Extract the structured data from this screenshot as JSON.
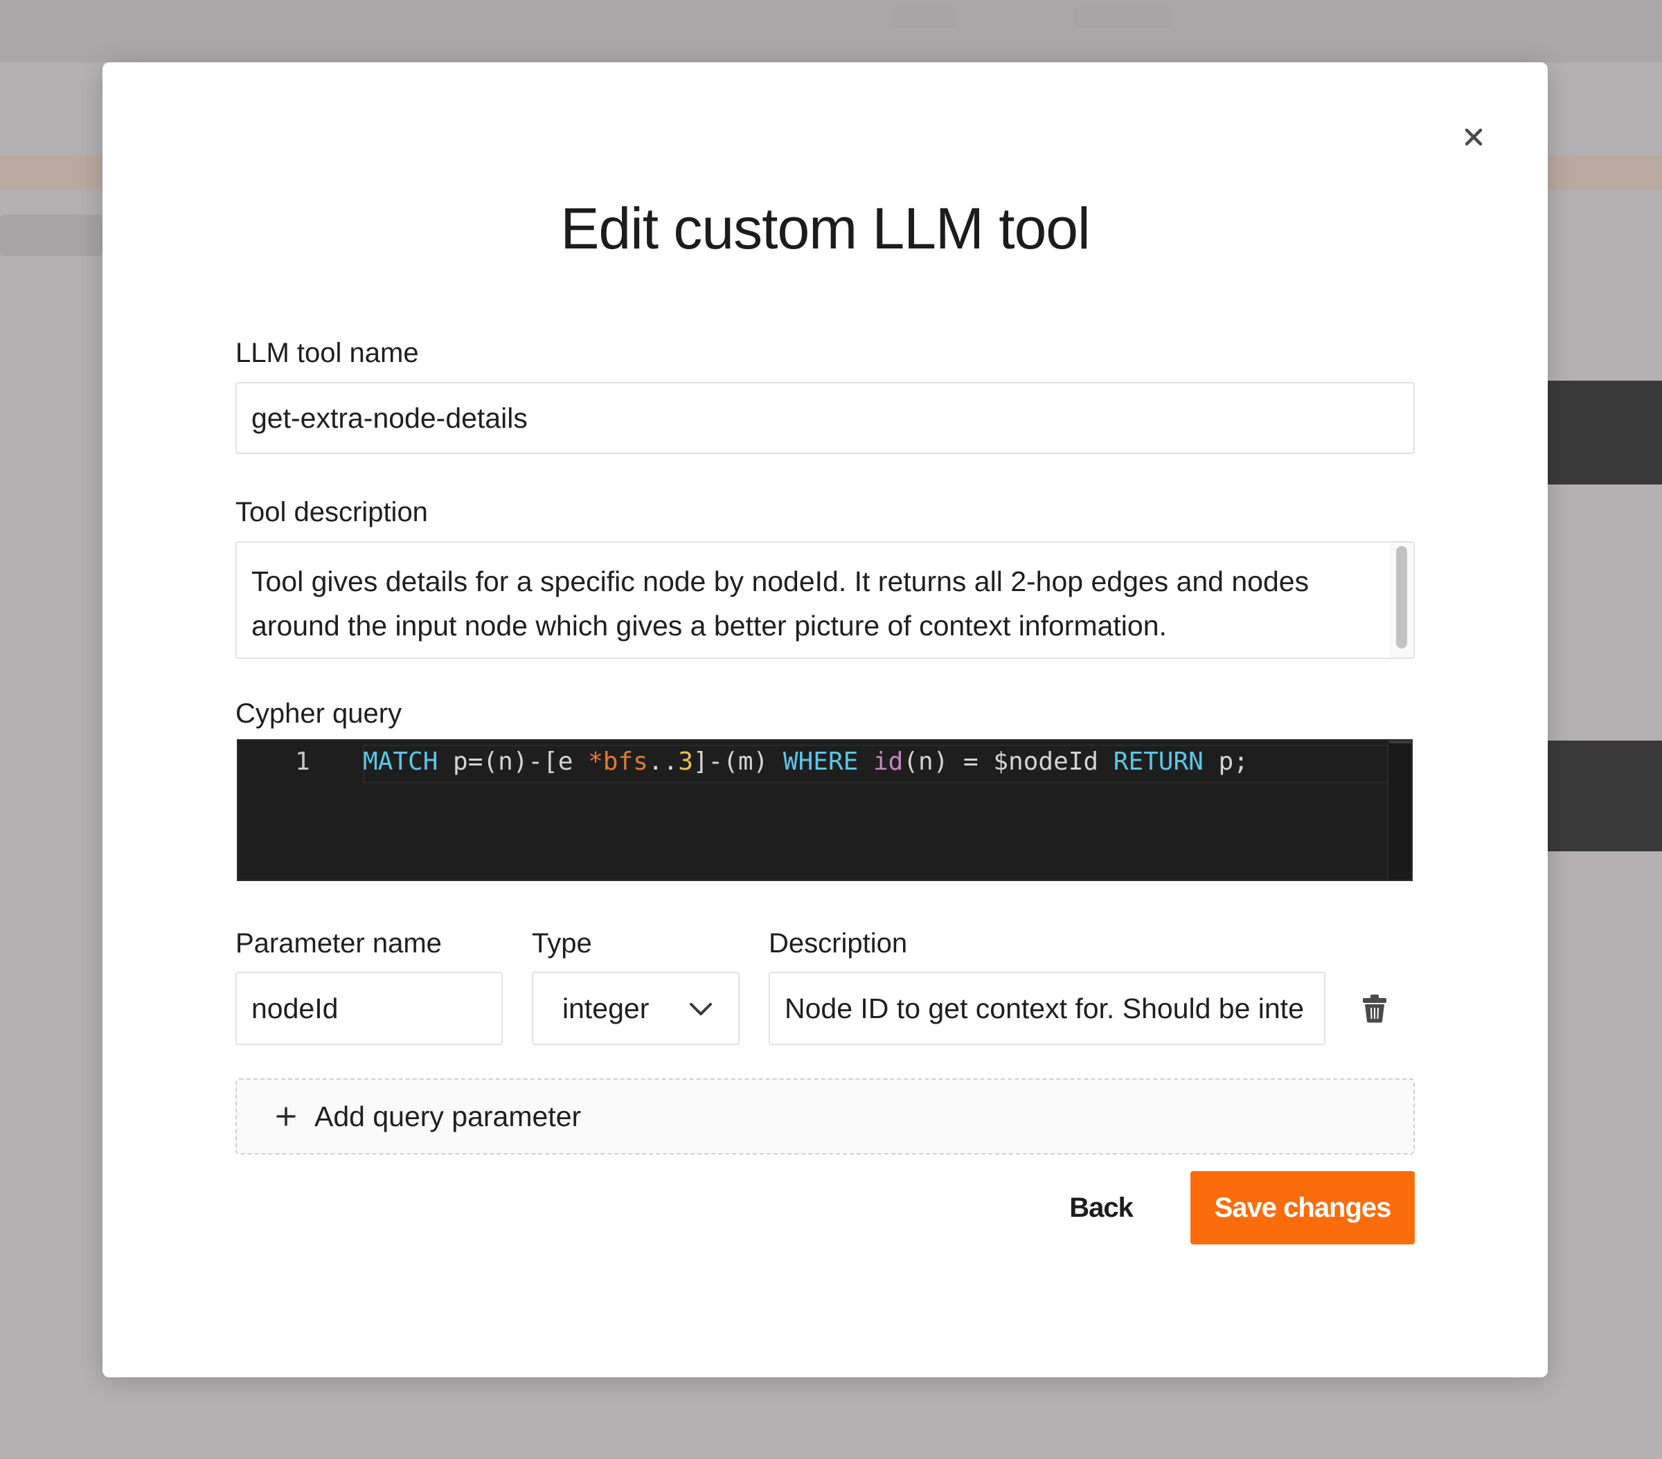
{
  "modal": {
    "title": "Edit custom LLM tool",
    "close_icon": "close-icon"
  },
  "tool_name": {
    "label": "LLM tool name",
    "value": "get-extra-node-details"
  },
  "tool_description": {
    "label": "Tool description",
    "value": "Tool gives details for a specific node by nodeId. It returns all 2-hop edges and nodes around the input node which gives a better picture of context information."
  },
  "cypher_query": {
    "label": "Cypher query",
    "line_number": "1",
    "tokens": {
      "t1": "MATCH",
      "t2": " p=(n)-[e ",
      "t3": "*bfs",
      "t4": "..",
      "t5": "3",
      "t6": "]-(m) ",
      "t7": "WHERE",
      "t8": " ",
      "t9": "id",
      "t10": "(n) = $nodeId ",
      "t11": "RETURN",
      "t12": " p;"
    }
  },
  "parameters": {
    "headers": {
      "name": "Parameter name",
      "type": "Type",
      "description": "Description"
    },
    "rows": [
      {
        "name": "nodeId",
        "type": "integer",
        "description": "Node ID to get context for. Should be inte"
      }
    ],
    "add_label": "Add query parameter"
  },
  "footer": {
    "back_label": "Back",
    "save_label": "Save changes"
  },
  "colors": {
    "accent": "#fb6d0c",
    "code_background": "#1e1e1e",
    "keyword": "#5bc6e6",
    "function": "#c586c0"
  }
}
